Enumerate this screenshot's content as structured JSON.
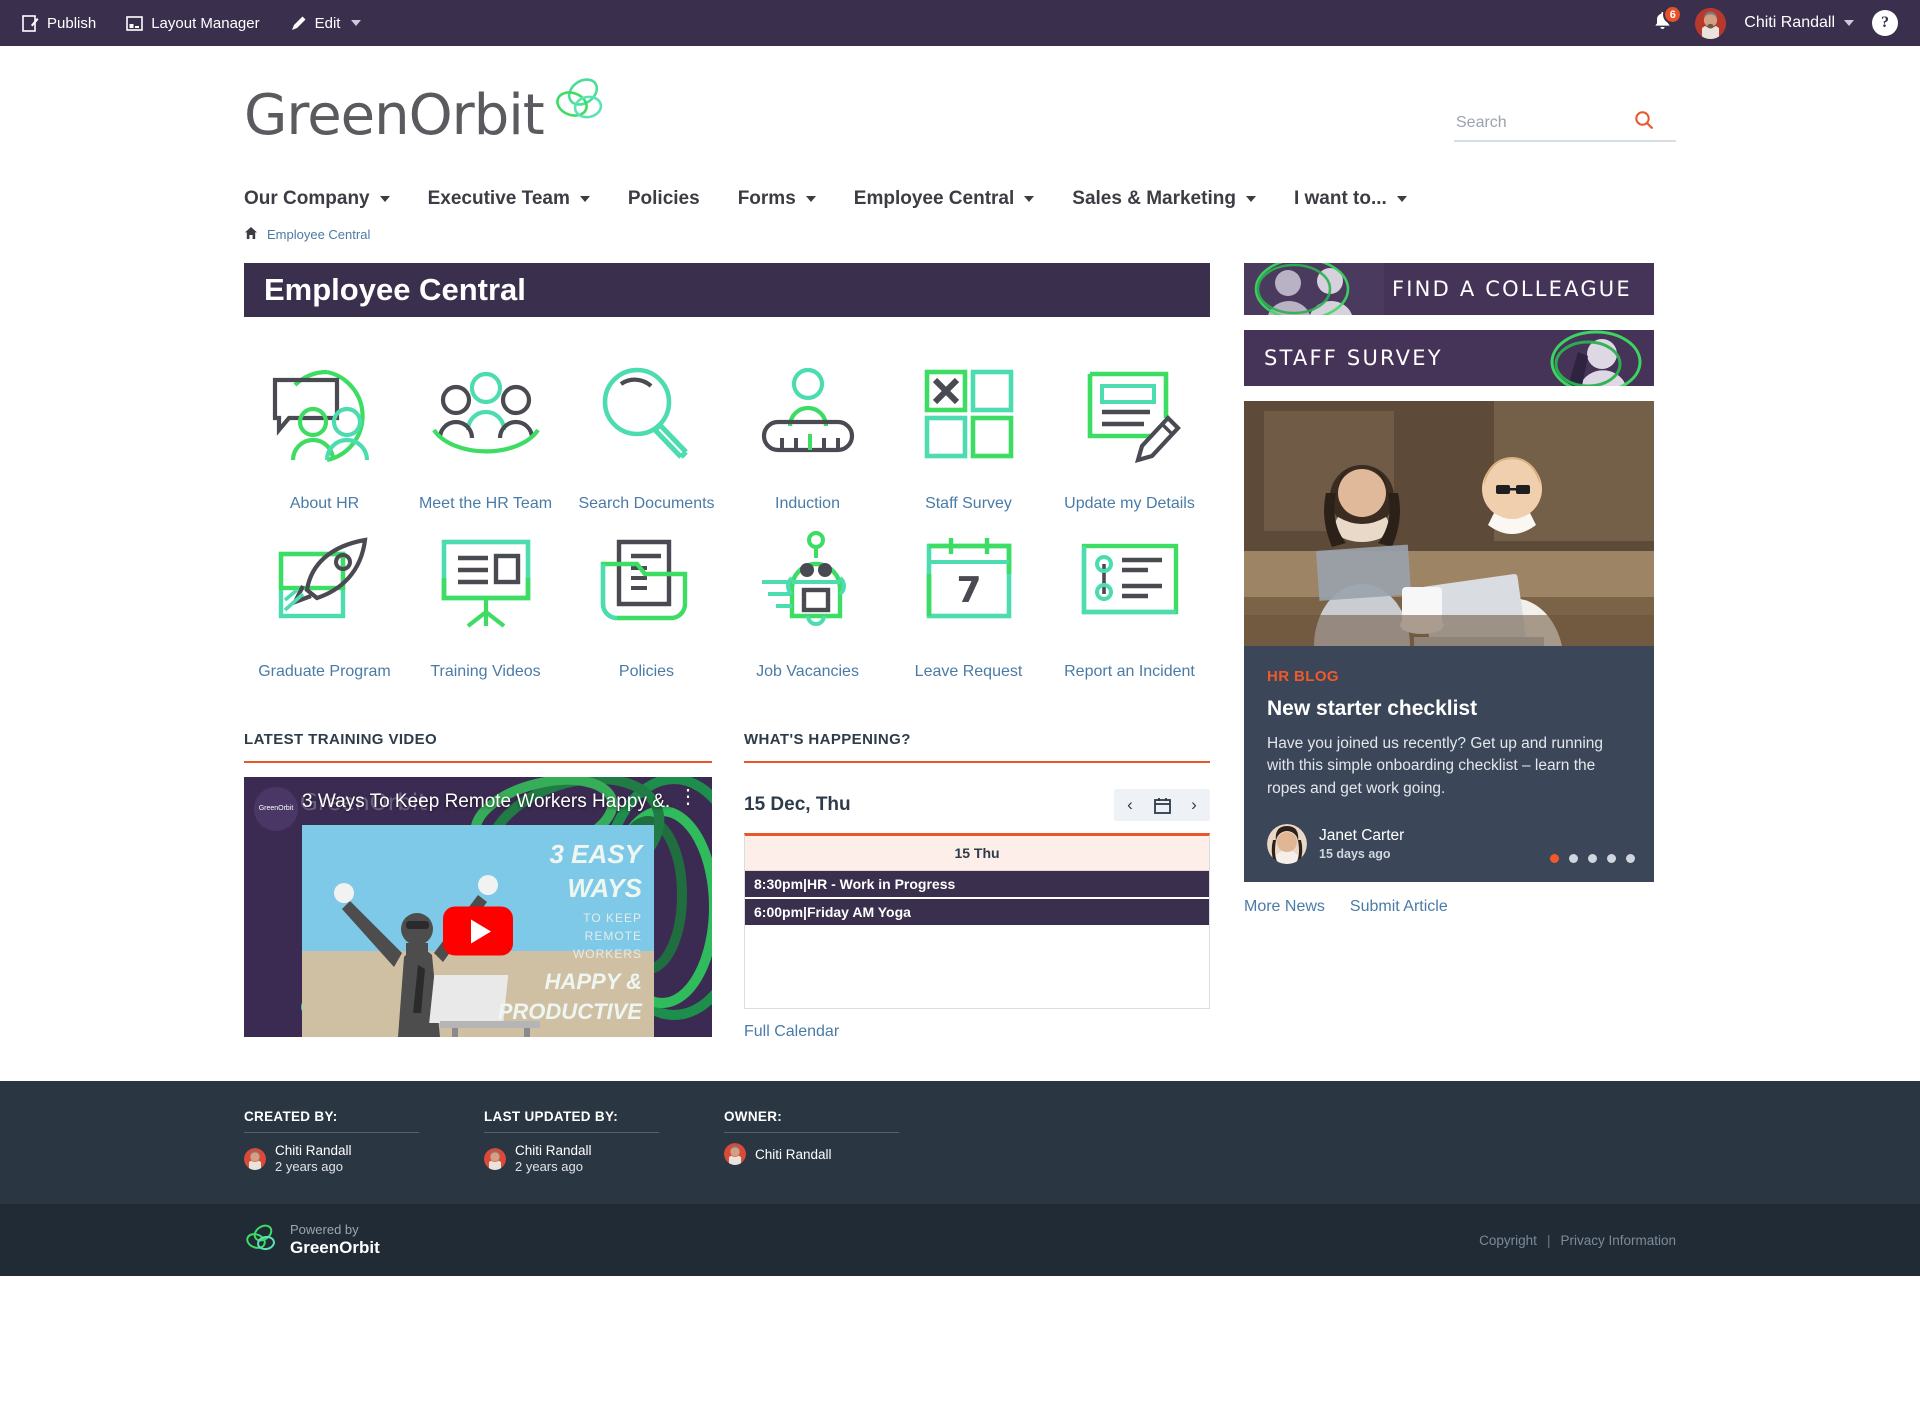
{
  "adminbar": {
    "publish": "Publish",
    "layout_manager": "Layout Manager",
    "edit": "Edit",
    "notification_count": "6",
    "user_name": "Chiti Randall",
    "help": "?"
  },
  "header": {
    "logo_text": "GreenOrbit",
    "search_placeholder": "Search",
    "search_value": ""
  },
  "nav": {
    "items": [
      {
        "label": "Our Company",
        "caret": true
      },
      {
        "label": "Executive Team",
        "caret": true
      },
      {
        "label": "Policies",
        "caret": false
      },
      {
        "label": "Forms",
        "caret": true
      },
      {
        "label": "Employee Central",
        "caret": true
      },
      {
        "label": "Sales & Marketing",
        "caret": true
      },
      {
        "label": "I want to...",
        "caret": true
      }
    ]
  },
  "breadcrumb": {
    "home_icon": "home-icon",
    "current": "Employee Central"
  },
  "main": {
    "page_title": "Employee Central",
    "tiles": [
      {
        "label": "About HR",
        "icon": "speech-bubble-people-icon"
      },
      {
        "label": "Meet the HR Team",
        "icon": "three-people-icon"
      },
      {
        "label": "Search Documents",
        "icon": "magnifier-icon"
      },
      {
        "label": "Induction",
        "icon": "person-ruler-icon"
      },
      {
        "label": "Staff Survey",
        "icon": "checkbox-grid-icon"
      },
      {
        "label": "Update my Details",
        "icon": "form-pencil-icon"
      },
      {
        "label": "Graduate Program",
        "icon": "rocket-icon"
      },
      {
        "label": "Training Videos",
        "icon": "presentation-board-icon"
      },
      {
        "label": "Policies",
        "icon": "document-folder-icon"
      },
      {
        "label": "Job Vacancies",
        "icon": "robot-icon"
      },
      {
        "label": "Leave Request",
        "icon": "calendar-7-icon"
      },
      {
        "label": "Report an Incident",
        "icon": "timeline-report-icon"
      }
    ]
  },
  "video_widget": {
    "title": "LATEST TRAINING VIDEO",
    "video_title": "3 Ways To Keep Remote Workers Happy &...",
    "channel": "GreenOrbit",
    "thumb_line1": "3 EASY",
    "thumb_line2": "WAYS",
    "thumb_sub1": "TO KEEP",
    "thumb_sub2": "REMOTE",
    "thumb_sub3": "WORKERS",
    "thumb_line3": "HAPPY &",
    "thumb_line4": "PRODUCTIVE"
  },
  "calendar_widget": {
    "title": "WHAT'S HAPPENING?",
    "date_label": "15 Dec, Thu",
    "prev": "‹",
    "next": "›",
    "day_header": "15 Thu",
    "events": [
      {
        "time": "8:30pm",
        "name": "HR - Work in Progress"
      },
      {
        "time": "6:00pm",
        "name": "Friday AM Yoga"
      }
    ],
    "full_calendar": "Full Calendar"
  },
  "sidebar": {
    "banners": [
      {
        "label": "FIND A COLLEAGUE",
        "photo_side": "left"
      },
      {
        "label": "STAFF SURVEY",
        "photo_side": "right"
      }
    ],
    "news": {
      "kicker": "HR BLOG",
      "title": "New starter checklist",
      "text": "Have you joined us recently? Get up and running with this simple onboarding checklist – learn the ropes and get work going.",
      "author": "Janet Carter",
      "time": "15 days ago",
      "dots": 5,
      "active_dot": 0,
      "accent": "#f1592a"
    },
    "links": [
      "More News",
      "Submit Article"
    ]
  },
  "footer_meta": {
    "columns": [
      {
        "label": "CREATED BY:",
        "name": "Chiti Randall",
        "time": "2 years ago"
      },
      {
        "label": "LAST UPDATED BY:",
        "name": "Chiti Randall",
        "time": "2 years ago"
      },
      {
        "label": "OWNER:",
        "name": "Chiti Randall",
        "time": ""
      }
    ]
  },
  "footer_bottom": {
    "powered_by": "Powered by",
    "brand": "GreenOrbit",
    "copyright": "Copyright",
    "separator": "|",
    "privacy": "Privacy Information"
  },
  "colors": {
    "purple": "#3a2f4d",
    "orange": "#e8572a",
    "link_blue": "#4a7ba7",
    "green": "#3ddc62",
    "teal": "#4ddcb0"
  }
}
